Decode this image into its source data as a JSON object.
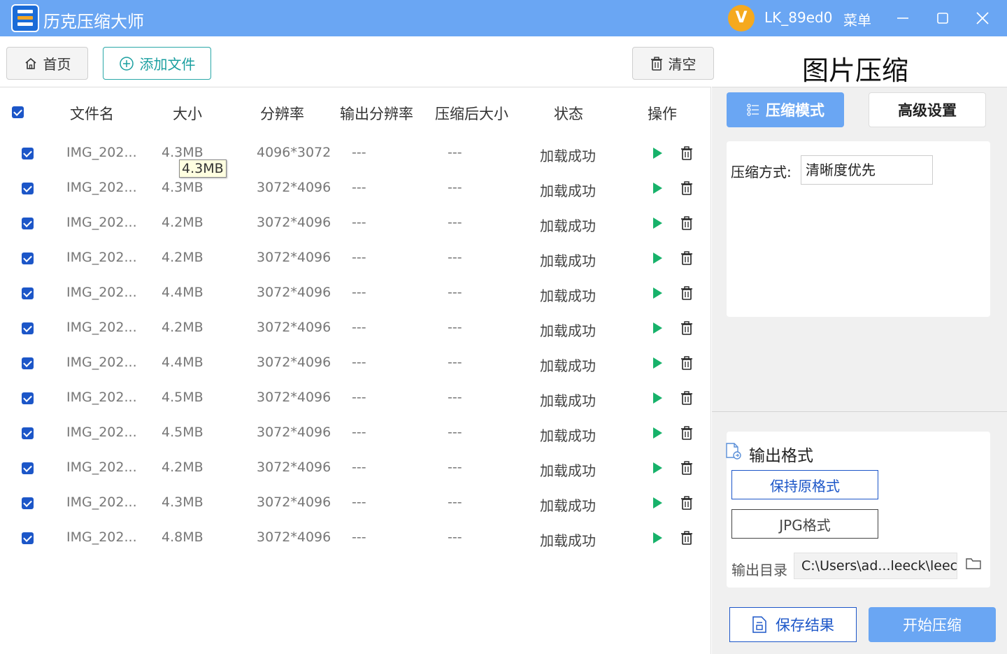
{
  "titlebar": {
    "app_title": "历克压缩大师",
    "avatar_letter": "V",
    "username": "LK_89ed0",
    "menu_label": "菜单"
  },
  "toolbar": {
    "home_label": "首页",
    "add_label": "添加文件",
    "clear_label": "清空",
    "page_title": "图片压缩"
  },
  "table": {
    "headers": [
      "文件名",
      "大小",
      "分辨率",
      "输出分辨率",
      "压缩后大小",
      "状态",
      "操作"
    ],
    "tooltip": "4.3MB",
    "rows": [
      {
        "name": "IMG_202...",
        "size": "4.3MB",
        "res": "4096*3072",
        "out_res": "---",
        "out_size": "---",
        "status": "加载成功"
      },
      {
        "name": "IMG_202...",
        "size": "4.3MB",
        "res": "3072*4096",
        "out_res": "---",
        "out_size": "---",
        "status": "加载成功"
      },
      {
        "name": "IMG_202...",
        "size": "4.2MB",
        "res": "3072*4096",
        "out_res": "---",
        "out_size": "---",
        "status": "加载成功"
      },
      {
        "name": "IMG_202...",
        "size": "4.2MB",
        "res": "3072*4096",
        "out_res": "---",
        "out_size": "---",
        "status": "加载成功"
      },
      {
        "name": "IMG_202...",
        "size": "4.4MB",
        "res": "3072*4096",
        "out_res": "---",
        "out_size": "---",
        "status": "加载成功"
      },
      {
        "name": "IMG_202...",
        "size": "4.2MB",
        "res": "3072*4096",
        "out_res": "---",
        "out_size": "---",
        "status": "加载成功"
      },
      {
        "name": "IMG_202...",
        "size": "4.4MB",
        "res": "3072*4096",
        "out_res": "---",
        "out_size": "---",
        "status": "加载成功"
      },
      {
        "name": "IMG_202...",
        "size": "4.5MB",
        "res": "3072*4096",
        "out_res": "---",
        "out_size": "---",
        "status": "加载成功"
      },
      {
        "name": "IMG_202...",
        "size": "4.5MB",
        "res": "3072*4096",
        "out_res": "---",
        "out_size": "---",
        "status": "加载成功"
      },
      {
        "name": "IMG_202...",
        "size": "4.2MB",
        "res": "3072*4096",
        "out_res": "---",
        "out_size": "---",
        "status": "加载成功"
      },
      {
        "name": "IMG_202...",
        "size": "4.3MB",
        "res": "3072*4096",
        "out_res": "---",
        "out_size": "---",
        "status": "加载成功"
      },
      {
        "name": "IMG_202...",
        "size": "4.8MB",
        "res": "3072*4096",
        "out_res": "---",
        "out_size": "---",
        "status": "加载成功"
      }
    ]
  },
  "right_panel": {
    "tab_mode": "压缩模式",
    "tab_advanced": "高级设置",
    "mode_label": "压缩方式:",
    "mode_value": "清晰度优先",
    "output_title": "输出格式",
    "format_keep": "保持原格式",
    "format_jpg": "JPG格式",
    "output_dir_label": "输出目录",
    "output_dir_value": "C:\\Users\\ad...leeck\\leeck",
    "save_label": "保存结果",
    "start_label": "开始压缩"
  },
  "colors": {
    "titlebar": "#6aa6f3",
    "checkbox": "#1c56c8",
    "play": "#17b26a",
    "add_button": "#1a9fa0",
    "avatar": "#f5a91e"
  },
  "icons": [
    "home-icon",
    "plus-circle-icon",
    "trash-icon",
    "play-icon",
    "sliders-icon",
    "file-convert-icon",
    "folder-icon",
    "save-document-icon",
    "minimize-icon",
    "maximize-icon",
    "close-icon"
  ]
}
